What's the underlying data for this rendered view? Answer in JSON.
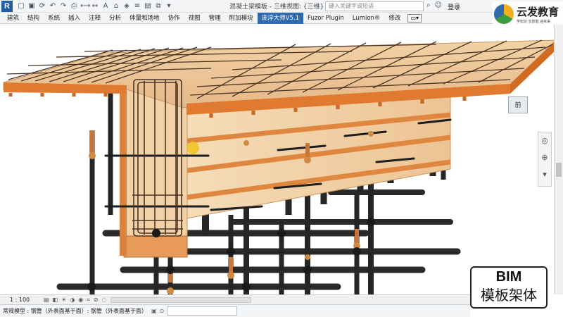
{
  "app": {
    "logo_letter": "R",
    "doc_title": "混凝土梁模板 - 三维视图: {三维}",
    "search_placeholder": "键入关键字或短语",
    "login_label": "登录"
  },
  "tabs": [
    {
      "label": "建筑",
      "active": false
    },
    {
      "label": "结构",
      "active": false
    },
    {
      "label": "系统",
      "active": false
    },
    {
      "label": "插入",
      "active": false
    },
    {
      "label": "注释",
      "active": false
    },
    {
      "label": "分析",
      "active": false
    },
    {
      "label": "体量和场地",
      "active": false
    },
    {
      "label": "协作",
      "active": false
    },
    {
      "label": "视图",
      "active": false
    },
    {
      "label": "管理",
      "active": false
    },
    {
      "label": "附加模块",
      "active": false
    },
    {
      "label": "庞淳大师V5.1",
      "active": true
    },
    {
      "label": "Fuzor Plugin",
      "active": false
    },
    {
      "label": "Lumion®",
      "active": false
    },
    {
      "label": "修改",
      "active": false
    }
  ],
  "brand": {
    "name": "云发教育",
    "slogan": "学知识 长技能 迎未来"
  },
  "viewcube": {
    "face_label": "前"
  },
  "overlay_label": {
    "title": "BIM",
    "subtitle": "模板架体"
  },
  "viewbar": {
    "scale": "1 : 100"
  },
  "statusbar": {
    "text": "常规模型 : 钢管（外表面基于面）: 钢管（外表面基于面）"
  },
  "colors": {
    "active_tab": "#2e6aad",
    "formwork": "#e89a5a",
    "plywood": "#f3d2a8",
    "steel": "#2a2a2a",
    "rebar": "#5a4030"
  }
}
